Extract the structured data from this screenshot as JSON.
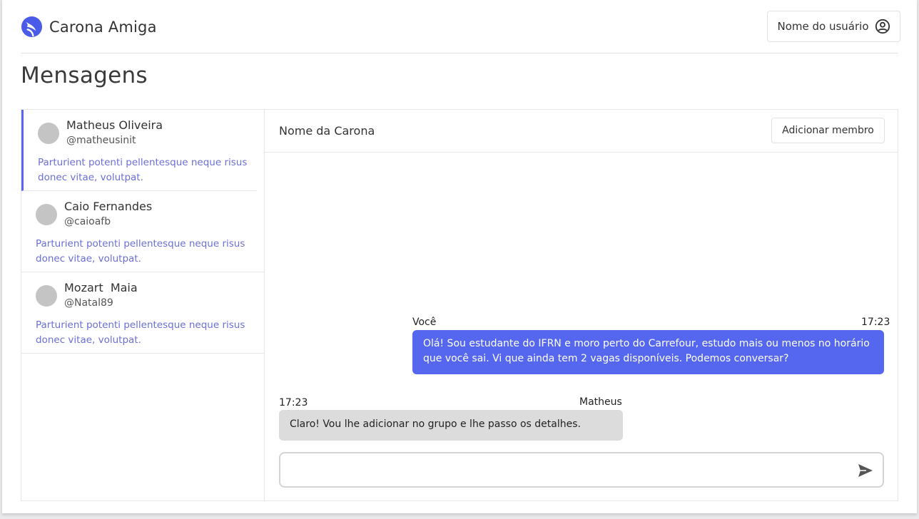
{
  "header": {
    "brand_name": "Carona Amiga",
    "user_button_label": "Nome do usuário"
  },
  "page_title": "Mensagens",
  "conversations": [
    {
      "name": "Matheus Oliveira",
      "handle": "@matheusinit",
      "preview": "Parturient potenti pellentesque neque risus donec vitae, volutpat.",
      "active": true
    },
    {
      "name": "Caio Fernandes",
      "handle": "@caioafb",
      "preview": "Parturient potenti pellentesque neque risus donec vitae, volutpat.",
      "active": false
    },
    {
      "name": "Mozart  Maia",
      "handle": "@Natal89",
      "preview": "Parturient potenti pellentesque neque risus donec vitae, volutpat.",
      "active": false
    }
  ],
  "chat": {
    "title": "Nome da Carona",
    "add_member_label": "Adicionar membro",
    "messages": [
      {
        "sender": "Você",
        "time": "17:23",
        "text": "Olá! Sou estudante do IFRN e moro perto do Carrefour, estudo mais ou menos no horário que você sai. Vi que ainda tem 2 vagas disponíveis. Podemos conversar?"
      },
      {
        "sender": "Matheus",
        "time": "17:23",
        "text": "Claro! Vou lhe adicionar no grupo e lhe passo os detalhes."
      }
    ],
    "composer_placeholder": ""
  },
  "colors": {
    "accent": "#5567ee",
    "preview_text": "#6b6fd9",
    "incoming_bubble": "#dcdcdc",
    "avatar_placeholder": "#c4c4c4"
  },
  "icons": {
    "brand": "carona-logo-icon",
    "user": "user-circle-icon",
    "send": "send-icon"
  }
}
